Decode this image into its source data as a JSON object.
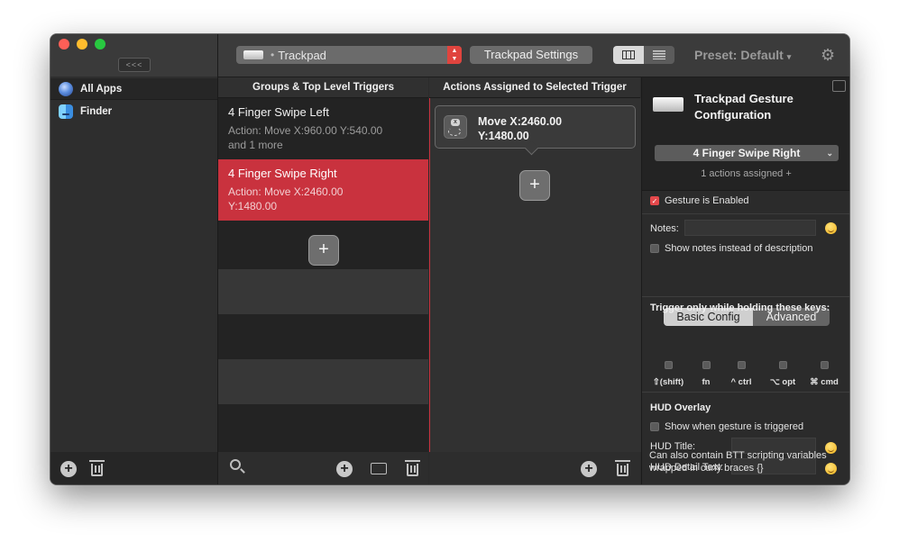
{
  "sidebar": {
    "collapse_label": "<<<",
    "items": [
      {
        "label": "All Apps"
      },
      {
        "label": "Finder"
      }
    ]
  },
  "toolbar": {
    "device_label": "Trackpad",
    "settings_button": "Trackpad Settings",
    "preset_label": "Preset: Default"
  },
  "columns": {
    "triggers_header": "Groups & Top Level Triggers",
    "actions_header": "Actions Assigned to Selected Trigger"
  },
  "triggers": [
    {
      "title": "4 Finger Swipe Left",
      "desc": "Action: Move X:960.00 Y:540.00\nand 1 more",
      "selected": false
    },
    {
      "title": "4 Finger Swipe Right",
      "desc": "Action: Move X:2460.00\nY:1480.00",
      "selected": true
    }
  ],
  "actions": [
    {
      "text": "Move X:2460.00\nY:1480.00"
    }
  ],
  "config": {
    "title": "Trackpad Gesture Configuration",
    "selected_trigger": "4 Finger Swipe Right",
    "assigned_text": "1 actions assigned +",
    "gesture_enabled_label": "Gesture is Enabled",
    "gesture_enabled": true,
    "notes_label": "Notes:",
    "show_notes_label": "Show notes instead of description",
    "tabs": [
      "Basic Config",
      "Advanced"
    ],
    "active_tab": "Basic Config",
    "modifier_heading": "Trigger only while holding these keys:",
    "modifiers": [
      "⇧(shift)",
      "fn",
      "^ ctrl",
      "⌥ opt",
      "⌘ cmd"
    ],
    "hud_heading": "HUD Overlay",
    "hud_show_label": "Show when gesture is triggered",
    "hud_title_label": "HUD Title:",
    "hud_detail_label": "HUD Detail Text:",
    "scripting_note": "Can also contain BTT scripting variables wrapped in curly braces {}"
  },
  "colors": {
    "accent_red": "#c9323e",
    "window_bg": "#2b2b2b"
  }
}
